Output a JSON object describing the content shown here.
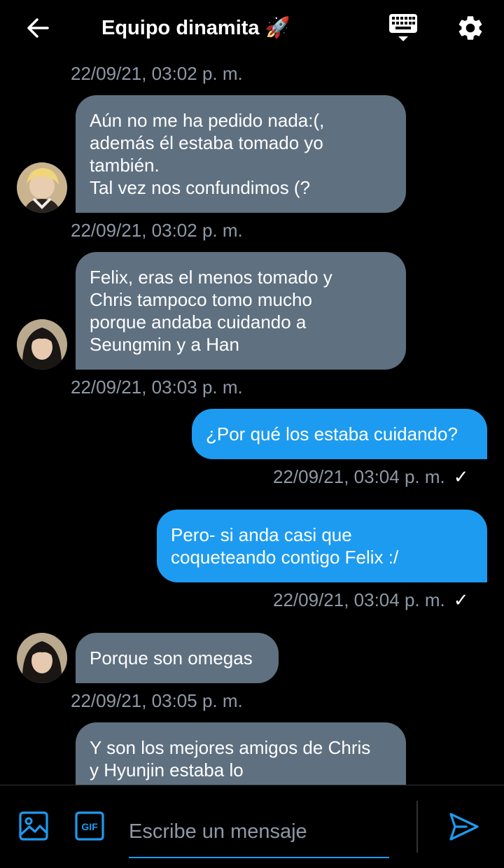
{
  "header": {
    "title": "Equipo dinamita 🚀"
  },
  "messages": [
    {
      "timestamp_above": "22/09/21, 03:02 p. m.",
      "lines": [
        "Aún no me ha pedido nada:(,",
        "además él estaba tomado yo",
        "también.",
        "Tal vez nos confundimos (?"
      ],
      "timestamp": "22/09/21, 03:02 p. m."
    },
    {
      "lines": [
        "Felix, eras el menos tomado y",
        "Chris tampoco tomo mucho",
        "porque andaba cuidando a",
        "Seungmin y a Han"
      ],
      "timestamp": "22/09/21, 03:03 p. m."
    },
    {
      "lines": [
        "¿Por qué los estaba cuidando?"
      ],
      "timestamp": "22/09/21, 03:04 p. m."
    },
    {
      "lines": [
        "Pero- si anda  casi que",
        "coqueteando contigo Felix :/"
      ],
      "timestamp": "22/09/21, 03:04 p. m."
    },
    {
      "lines": [
        "Porque son omegas"
      ],
      "timestamp": "22/09/21, 03:05 p. m."
    },
    {
      "lines": [
        "Y son los mejores amigos de Chris",
        "y Hyunjin estaba lo"
      ]
    }
  ],
  "read_mark": "✓",
  "composer": {
    "placeholder": "Escribe un mensaje",
    "gif_label": "GIF"
  },
  "colors": {
    "background": "#000000",
    "incoming_bubble": "#5f7080",
    "outgoing_bubble": "#1d9bf0",
    "accent": "#1d9bf0",
    "timestamp": "#8e99a6"
  },
  "icons": [
    "back-arrow-icon",
    "keyboard-icon",
    "gear-icon",
    "image-icon",
    "gif-icon",
    "send-icon",
    "rocket-emoji"
  ]
}
